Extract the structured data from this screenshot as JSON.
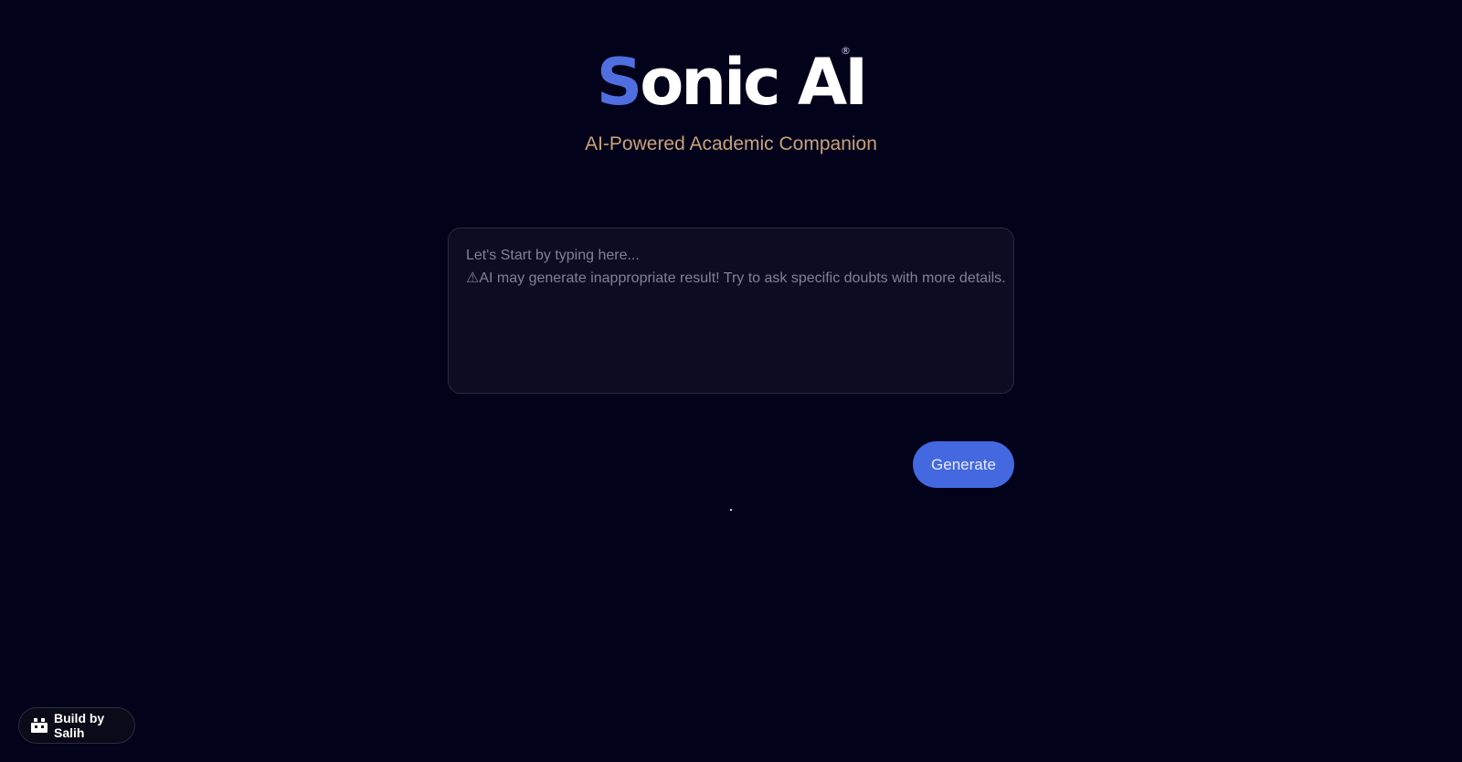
{
  "header": {
    "logo_first_letter": "S",
    "logo_rest": "onic AI",
    "logo_registered_mark": "®",
    "tagline": "AI-Powered Academic Companion"
  },
  "prompt": {
    "placeholder": "Let's Start by typing here...",
    "warning": "⚠AI may generate inappropriate result! Try to ask specific doubts with more details."
  },
  "actions": {
    "generate_label": "Generate"
  },
  "footer": {
    "badge_label": "Build by Salih",
    "badge_icon": "bot-icon"
  },
  "colors": {
    "background": "#02021a",
    "accent": "#4368e0",
    "logo_accent": "#4f6fe0",
    "tagline": "#c8a27a"
  }
}
